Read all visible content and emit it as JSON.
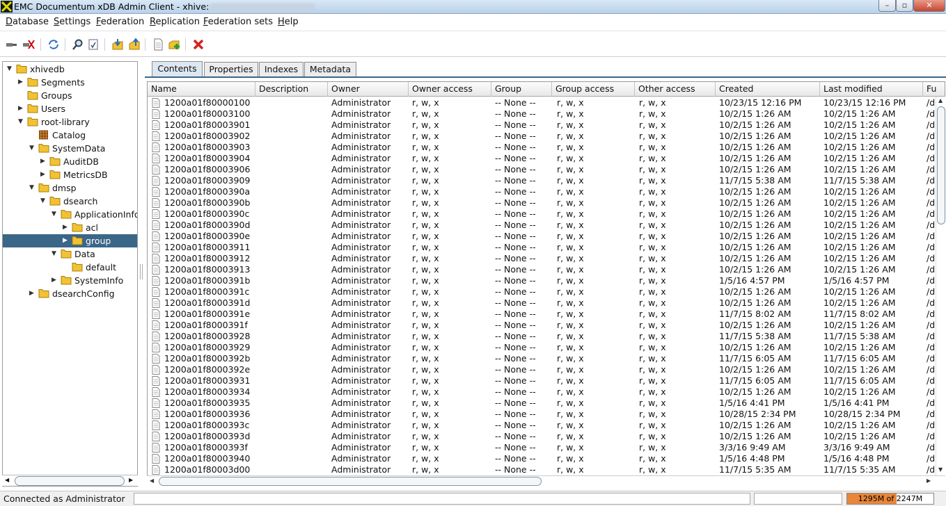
{
  "window": {
    "title": "EMC Documentum xDB Admin Client - xhive:",
    "min_label": "–",
    "max_label": "▫",
    "close_label": "✕"
  },
  "menu": [
    "Database",
    "Settings",
    "Federation",
    "Replication",
    "Federation sets",
    "Help"
  ],
  "menu_mnemonic": [
    "D",
    "S",
    "F",
    "R",
    "F",
    "H"
  ],
  "toolbar": [
    {
      "name": "connect-icon"
    },
    {
      "name": "disconnect-icon"
    },
    {
      "name": "refresh-icon"
    },
    {
      "name": "find-icon"
    },
    {
      "name": "query-icon"
    },
    {
      "name": "import-icon"
    },
    {
      "name": "export-icon"
    },
    {
      "name": "new-document-icon"
    },
    {
      "name": "add-library-icon"
    },
    {
      "name": "delete-icon"
    }
  ],
  "tree": [
    {
      "label": "xhivedb",
      "level": 0,
      "expanded": true
    },
    {
      "label": "Segments",
      "level": 1,
      "expanded": false
    },
    {
      "label": "Groups",
      "level": 1,
      "leaf": true
    },
    {
      "label": "Users",
      "level": 1,
      "expanded": false
    },
    {
      "label": "root-library",
      "level": 1,
      "expanded": true
    },
    {
      "label": "Catalog",
      "level": 2,
      "leaf": true,
      "catalog": true
    },
    {
      "label": "SystemData",
      "level": 2,
      "expanded": true
    },
    {
      "label": "AuditDB",
      "level": 3,
      "expanded": false
    },
    {
      "label": "MetricsDB",
      "level": 3,
      "expanded": false
    },
    {
      "label": "dmsp",
      "level": 2,
      "expanded": true
    },
    {
      "label": "dsearch",
      "level": 3,
      "expanded": true
    },
    {
      "label": "ApplicationInfo",
      "level": 4,
      "expanded": true
    },
    {
      "label": "acl",
      "level": 5,
      "expanded": false
    },
    {
      "label": "group",
      "level": 5,
      "expanded": false,
      "selected": true
    },
    {
      "label": "Data",
      "level": 4,
      "expanded": true
    },
    {
      "label": "default",
      "level": 5,
      "leaf": true
    },
    {
      "label": "SystemInfo",
      "level": 4,
      "expanded": false
    },
    {
      "label": "dsearchConfig",
      "level": 2,
      "expanded": false
    }
  ],
  "tabs": [
    {
      "label": "Contents",
      "active": true
    },
    {
      "label": "Properties"
    },
    {
      "label": "Indexes"
    },
    {
      "label": "Metadata"
    }
  ],
  "columns": [
    "Name",
    "Description",
    "Owner",
    "Owner access",
    "Group",
    "Group access",
    "Other access",
    "Created",
    "Last modified",
    "Fu"
  ],
  "rows": [
    [
      "1200a01f80000100",
      "",
      "Administrator",
      "r, w, x",
      "-- None --",
      "r, w, x",
      "r, w, x",
      "10/23/15 12:16 PM",
      "10/23/15 12:16 PM",
      "/d"
    ],
    [
      "1200a01f80003100",
      "",
      "Administrator",
      "r, w, x",
      "-- None --",
      "r, w, x",
      "r, w, x",
      "10/2/15 1:26 AM",
      "10/2/15 1:26 AM",
      "/d"
    ],
    [
      "1200a01f80003901",
      "",
      "Administrator",
      "r, w, x",
      "-- None --",
      "r, w, x",
      "r, w, x",
      "10/2/15 1:26 AM",
      "10/2/15 1:26 AM",
      "/d"
    ],
    [
      "1200a01f80003902",
      "",
      "Administrator",
      "r, w, x",
      "-- None --",
      "r, w, x",
      "r, w, x",
      "10/2/15 1:26 AM",
      "10/2/15 1:26 AM",
      "/d"
    ],
    [
      "1200a01f80003903",
      "",
      "Administrator",
      "r, w, x",
      "-- None --",
      "r, w, x",
      "r, w, x",
      "10/2/15 1:26 AM",
      "10/2/15 1:26 AM",
      "/d"
    ],
    [
      "1200a01f80003904",
      "",
      "Administrator",
      "r, w, x",
      "-- None --",
      "r, w, x",
      "r, w, x",
      "10/2/15 1:26 AM",
      "10/2/15 1:26 AM",
      "/d"
    ],
    [
      "1200a01f80003906",
      "",
      "Administrator",
      "r, w, x",
      "-- None --",
      "r, w, x",
      "r, w, x",
      "10/2/15 1:26 AM",
      "10/2/15 1:26 AM",
      "/d"
    ],
    [
      "1200a01f80003909",
      "",
      "Administrator",
      "r, w, x",
      "-- None --",
      "r, w, x",
      "r, w, x",
      "11/7/15 5:38 AM",
      "11/7/15 5:38 AM",
      "/d"
    ],
    [
      "1200a01f8000390a",
      "",
      "Administrator",
      "r, w, x",
      "-- None --",
      "r, w, x",
      "r, w, x",
      "10/2/15 1:26 AM",
      "10/2/15 1:26 AM",
      "/d"
    ],
    [
      "1200a01f8000390b",
      "",
      "Administrator",
      "r, w, x",
      "-- None --",
      "r, w, x",
      "r, w, x",
      "10/2/15 1:26 AM",
      "10/2/15 1:26 AM",
      "/d"
    ],
    [
      "1200a01f8000390c",
      "",
      "Administrator",
      "r, w, x",
      "-- None --",
      "r, w, x",
      "r, w, x",
      "10/2/15 1:26 AM",
      "10/2/15 1:26 AM",
      "/d"
    ],
    [
      "1200a01f8000390d",
      "",
      "Administrator",
      "r, w, x",
      "-- None --",
      "r, w, x",
      "r, w, x",
      "10/2/15 1:26 AM",
      "10/2/15 1:26 AM",
      "/d"
    ],
    [
      "1200a01f8000390e",
      "",
      "Administrator",
      "r, w, x",
      "-- None --",
      "r, w, x",
      "r, w, x",
      "10/2/15 1:26 AM",
      "10/2/15 1:26 AM",
      "/d"
    ],
    [
      "1200a01f80003911",
      "",
      "Administrator",
      "r, w, x",
      "-- None --",
      "r, w, x",
      "r, w, x",
      "10/2/15 1:26 AM",
      "10/2/15 1:26 AM",
      "/d"
    ],
    [
      "1200a01f80003912",
      "",
      "Administrator",
      "r, w, x",
      "-- None --",
      "r, w, x",
      "r, w, x",
      "10/2/15 1:26 AM",
      "10/2/15 1:26 AM",
      "/d"
    ],
    [
      "1200a01f80003913",
      "",
      "Administrator",
      "r, w, x",
      "-- None --",
      "r, w, x",
      "r, w, x",
      "10/2/15 1:26 AM",
      "10/2/15 1:26 AM",
      "/d"
    ],
    [
      "1200a01f8000391b",
      "",
      "Administrator",
      "r, w, x",
      "-- None --",
      "r, w, x",
      "r, w, x",
      "1/5/16 4:57 PM",
      "1/5/16 4:57 PM",
      "/d"
    ],
    [
      "1200a01f8000391c",
      "",
      "Administrator",
      "r, w, x",
      "-- None --",
      "r, w, x",
      "r, w, x",
      "10/2/15 1:26 AM",
      "10/2/15 1:26 AM",
      "/d"
    ],
    [
      "1200a01f8000391d",
      "",
      "Administrator",
      "r, w, x",
      "-- None --",
      "r, w, x",
      "r, w, x",
      "10/2/15 1:26 AM",
      "10/2/15 1:26 AM",
      "/d"
    ],
    [
      "1200a01f8000391e",
      "",
      "Administrator",
      "r, w, x",
      "-- None --",
      "r, w, x",
      "r, w, x",
      "11/7/15 8:02 AM",
      "11/7/15 8:02 AM",
      "/d"
    ],
    [
      "1200a01f8000391f",
      "",
      "Administrator",
      "r, w, x",
      "-- None --",
      "r, w, x",
      "r, w, x",
      "10/2/15 1:26 AM",
      "10/2/15 1:26 AM",
      "/d"
    ],
    [
      "1200a01f80003928",
      "",
      "Administrator",
      "r, w, x",
      "-- None --",
      "r, w, x",
      "r, w, x",
      "11/7/15 5:38 AM",
      "11/7/15 5:38 AM",
      "/d"
    ],
    [
      "1200a01f80003929",
      "",
      "Administrator",
      "r, w, x",
      "-- None --",
      "r, w, x",
      "r, w, x",
      "10/2/15 1:26 AM",
      "10/2/15 1:26 AM",
      "/d"
    ],
    [
      "1200a01f8000392b",
      "",
      "Administrator",
      "r, w, x",
      "-- None --",
      "r, w, x",
      "r, w, x",
      "11/7/15 6:05 AM",
      "11/7/15 6:05 AM",
      "/d"
    ],
    [
      "1200a01f8000392e",
      "",
      "Administrator",
      "r, w, x",
      "-- None --",
      "r, w, x",
      "r, w, x",
      "10/2/15 1:26 AM",
      "10/2/15 1:26 AM",
      "/d"
    ],
    [
      "1200a01f80003931",
      "",
      "Administrator",
      "r, w, x",
      "-- None --",
      "r, w, x",
      "r, w, x",
      "11/7/15 6:05 AM",
      "11/7/15 6:05 AM",
      "/d"
    ],
    [
      "1200a01f80003934",
      "",
      "Administrator",
      "r, w, x",
      "-- None --",
      "r, w, x",
      "r, w, x",
      "10/2/15 1:26 AM",
      "10/2/15 1:26 AM",
      "/d"
    ],
    [
      "1200a01f80003935",
      "",
      "Administrator",
      "r, w, x",
      "-- None --",
      "r, w, x",
      "r, w, x",
      "1/5/16 4:41 PM",
      "1/5/16 4:41 PM",
      "/d"
    ],
    [
      "1200a01f80003936",
      "",
      "Administrator",
      "r, w, x",
      "-- None --",
      "r, w, x",
      "r, w, x",
      "10/28/15 2:34 PM",
      "10/28/15 2:34 PM",
      "/d"
    ],
    [
      "1200a01f8000393c",
      "",
      "Administrator",
      "r, w, x",
      "-- None --",
      "r, w, x",
      "r, w, x",
      "10/2/15 1:26 AM",
      "10/2/15 1:26 AM",
      "/d"
    ],
    [
      "1200a01f8000393d",
      "",
      "Administrator",
      "r, w, x",
      "-- None --",
      "r, w, x",
      "r, w, x",
      "10/2/15 1:26 AM",
      "10/2/15 1:26 AM",
      "/d"
    ],
    [
      "1200a01f8000393f",
      "",
      "Administrator",
      "r, w, x",
      "-- None --",
      "r, w, x",
      "r, w, x",
      "3/3/16 9:49 AM",
      "3/3/16 9:49 AM",
      "/d"
    ],
    [
      "1200a01f80003940",
      "",
      "Administrator",
      "r, w, x",
      "-- None --",
      "r, w, x",
      "r, w, x",
      "1/5/16 4:48 PM",
      "1/5/16 4:48 PM",
      "/d"
    ],
    [
      "1200a01f80003d00",
      "",
      "Administrator",
      "r, w, x",
      "-- None --",
      "r, w, x",
      "r, w, x",
      "11/7/15 5:35 AM",
      "11/7/15 5:35 AM",
      "/d"
    ]
  ],
  "status": {
    "text": "Connected as Administrator",
    "memory_label": "1295M of 2247M",
    "memory_used_fraction": 0.576
  },
  "colors": {
    "selection": "#3a6688",
    "folder": "#f2c232",
    "memory_bar": "#e8863a"
  }
}
